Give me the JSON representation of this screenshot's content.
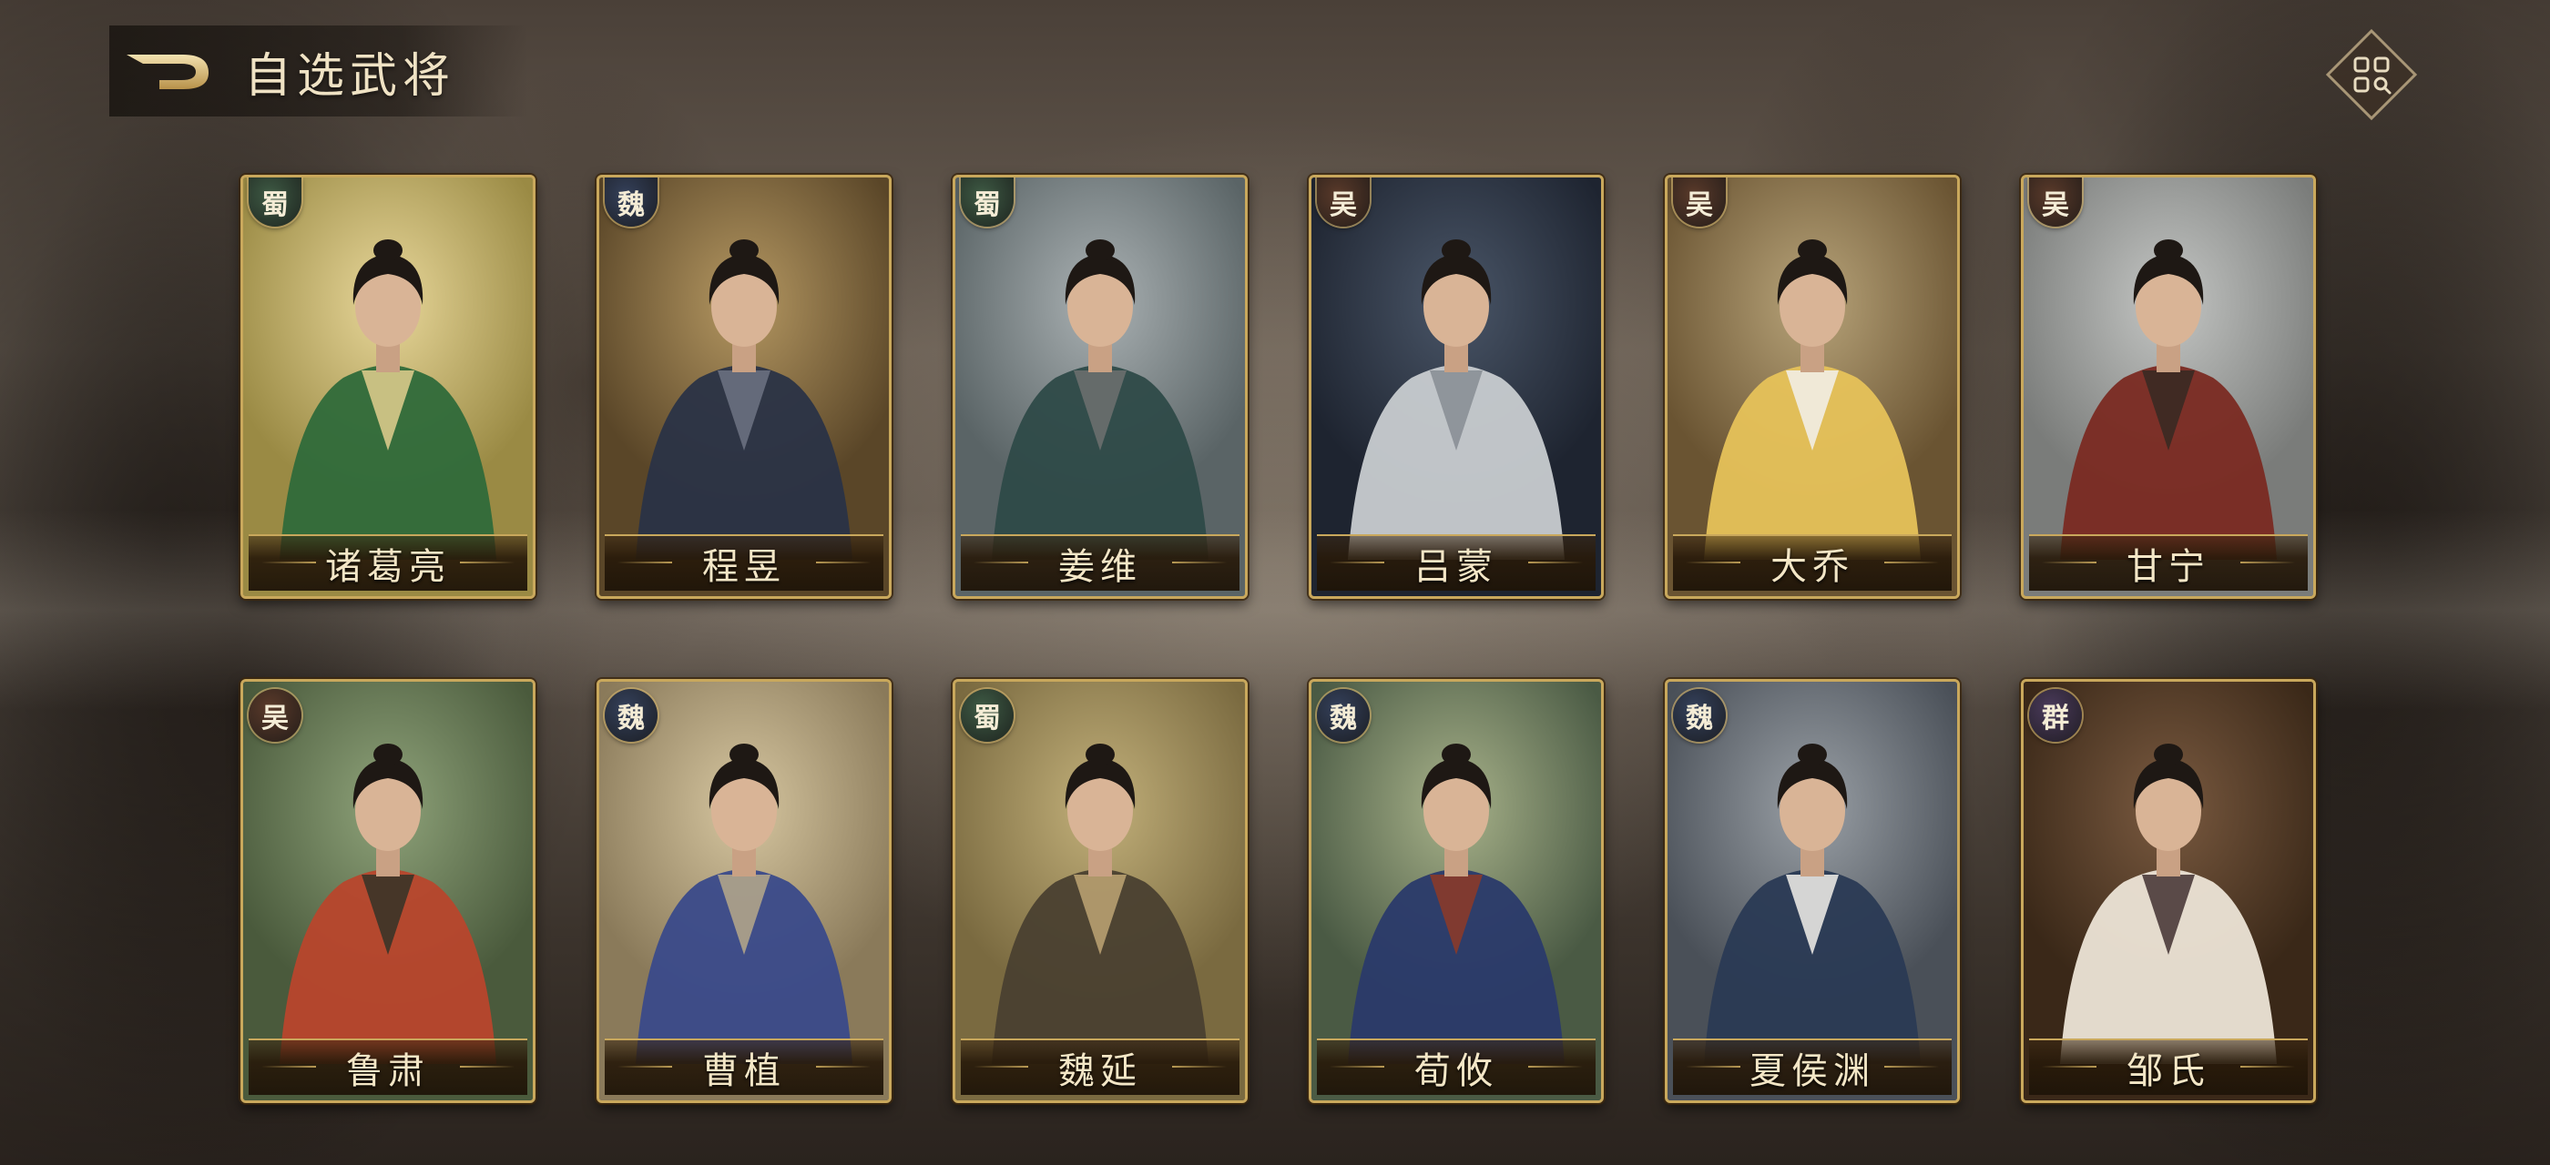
{
  "header": {
    "title": "自选武将"
  },
  "colors": {
    "gold": "#c9a85c",
    "title": "#efe2c4",
    "faction": {
      "蜀": "#3e5a44",
      "魏": "#34405a",
      "吴": "#5a3a2a",
      "群": "#4a3a5a"
    }
  },
  "heroes": [
    {
      "name": "诸葛亮",
      "faction": "蜀",
      "bg": [
        "#e8d79a",
        "#9a8a44"
      ],
      "robe": "#2f6a3a",
      "accent": "#d8c98a"
    },
    {
      "name": "程昱",
      "faction": "魏",
      "bg": [
        "#b59862",
        "#5a4628"
      ],
      "robe": "#2a3346",
      "accent": "#6a7080"
    },
    {
      "name": "姜维",
      "faction": "蜀",
      "bg": [
        "#aab1b3",
        "#5a6466"
      ],
      "robe": "#2e4a48",
      "accent": "#6a6f6e"
    },
    {
      "name": "吕蒙",
      "faction": "吴",
      "bg": [
        "#4a5668",
        "#1e2430"
      ],
      "robe": "#c8ccd0",
      "accent": "#8a8f96"
    },
    {
      "name": "大乔",
      "faction": "吴",
      "bg": [
        "#b8a47a",
        "#6a5432"
      ],
      "robe": "#e6c25a",
      "accent": "#f2ede4"
    },
    {
      "name": "甘宁",
      "faction": "吴",
      "bg": [
        "#c4c6c4",
        "#7a7c7a"
      ],
      "robe": "#7a2a22",
      "accent": "#3a2a22"
    },
    {
      "name": "鲁肃",
      "faction": "吴",
      "bg": [
        "#8fa37a",
        "#4a5a3c"
      ],
      "robe": "#b8462c",
      "accent": "#3a3428"
    },
    {
      "name": "曹植",
      "faction": "魏",
      "bg": [
        "#d6c6a0",
        "#8a7a5a"
      ],
      "robe": "#3a4a8a",
      "accent": "#b0a48a"
    },
    {
      "name": "魏延",
      "faction": "蜀",
      "bg": [
        "#c2b07a",
        "#7a6a40"
      ],
      "robe": "#4a4030",
      "accent": "#b8a070"
    },
    {
      "name": "荀攸",
      "faction": "魏",
      "bg": [
        "#a8b28a",
        "#4a5a44"
      ],
      "robe": "#2a3a6a",
      "accent": "#8a3a2a"
    },
    {
      "name": "夏侯渊",
      "faction": "魏",
      "bg": [
        "#9aa0a6",
        "#4a5058"
      ],
      "robe": "#2a3a54",
      "accent": "#e8e6e2"
    },
    {
      "name": "邹氏",
      "faction": "群",
      "bg": [
        "#7a5a40",
        "#3a2818"
      ],
      "robe": "#ece4d6",
      "accent": "#4a3a3a"
    }
  ]
}
